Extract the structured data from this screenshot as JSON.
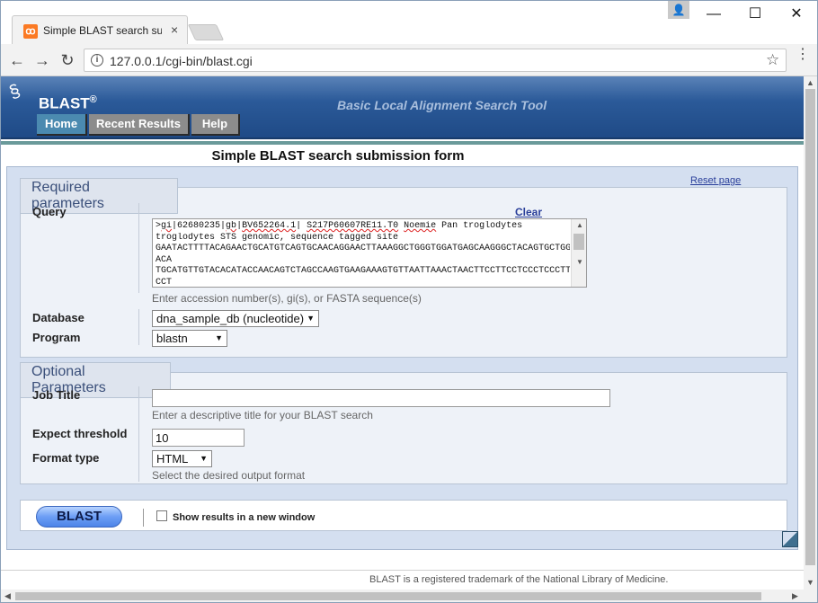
{
  "browser": {
    "tab_title": "Simple BLAST search sub",
    "tab_close": "×",
    "url": "127.0.0.1/cgi-bin/blast.cgi",
    "info_symbol": "i",
    "star_symbol": "☆",
    "back_symbol": "←",
    "forward_symbol": "→",
    "reload_symbol": "↻",
    "menu_symbol": "⋮",
    "minimize": "—",
    "maximize": "☐",
    "close": "✕",
    "profile_symbol": "👤"
  },
  "header": {
    "logo_text": "BLAST",
    "logo_sup": "®",
    "tagline": "Basic Local Alignment Search Tool",
    "nav": {
      "home": "Home",
      "recent": "Recent Results",
      "help": "Help"
    }
  },
  "form": {
    "title": "Simple BLAST search submission form",
    "reset": "Reset page",
    "required": {
      "legend": "Required parameters",
      "query_label": "Query",
      "clear": "Clear",
      "query_lines": [
        ">gi|62680235|gb|BV652264.1| S217P60607RE11.T0 Noemie Pan troglodytes",
        "troglodytes STS genomic, sequence tagged site",
        "GAATACTTTTACAGAACTGCATGTCAGTGCAACAGGAACTTAAAGGCTGGGTGGATGAGCAAGGGCTACAGTGCTGG",
        "ACA",
        "TGCATGTTGTACACATACCAACAGTCTAGCCAAGTGAAGAAAGTGTTAATTAAACTAACTTCCTTCCTCCCTCCCTT",
        "CCT"
      ],
      "query_hint": "Enter accession number(s), gi(s), or FASTA sequence(s)",
      "database_label": "Database",
      "database_value": "dna_sample_db (nucleotide)",
      "program_label": "Program",
      "program_value": "blastn"
    },
    "optional": {
      "legend": "Optional Parameters",
      "job_title_label": "Job Title",
      "job_title_value": "",
      "job_title_hint": "Enter a descriptive title for your BLAST search",
      "expect_label": "Expect threshold",
      "expect_value": "10",
      "format_label": "Format type",
      "format_value": "HTML",
      "format_hint": "Select the desired output format"
    },
    "submit": {
      "button": "BLAST",
      "new_window_label": "Show results in a new window"
    }
  },
  "footer": "BLAST is a registered trademark of the National Library of Medicine."
}
